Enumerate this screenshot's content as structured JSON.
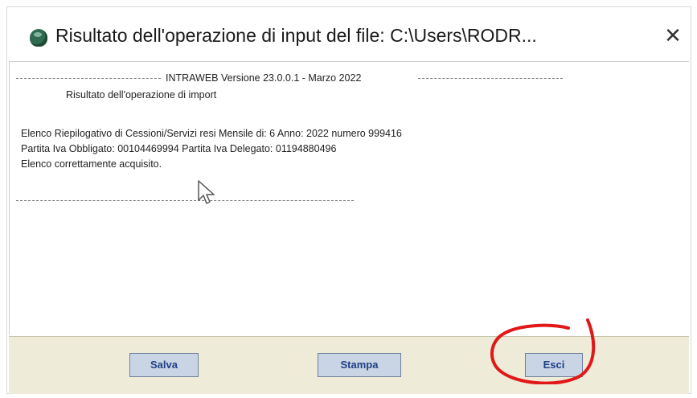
{
  "window": {
    "title": "Risultato dell'operazione di input del file: C:\\Users\\RODR...",
    "close_label": "✕"
  },
  "content": {
    "header": "INTRAWEB Versione 23.0.0.1 - Marzo 2022",
    "subtitle": "Risultato dell'operazione di import",
    "lines": [
      "Elenco Riepilogativo di Cessioni/Servizi resi Mensile di: 6 Anno: 2022 numero 999416",
      "Partita Iva Obbligato: 00104469994 Partita Iva Delegato: 01194880496",
      "Elenco correttamente acquisito."
    ]
  },
  "footer": {
    "buttons": [
      "Salva",
      "Stampa",
      "Esci"
    ]
  },
  "colors": {
    "footer_bg": "#eeecd9",
    "button_bg": "#c9d4e4",
    "button_text": "#1f3f86",
    "highlight": "#e01818"
  }
}
